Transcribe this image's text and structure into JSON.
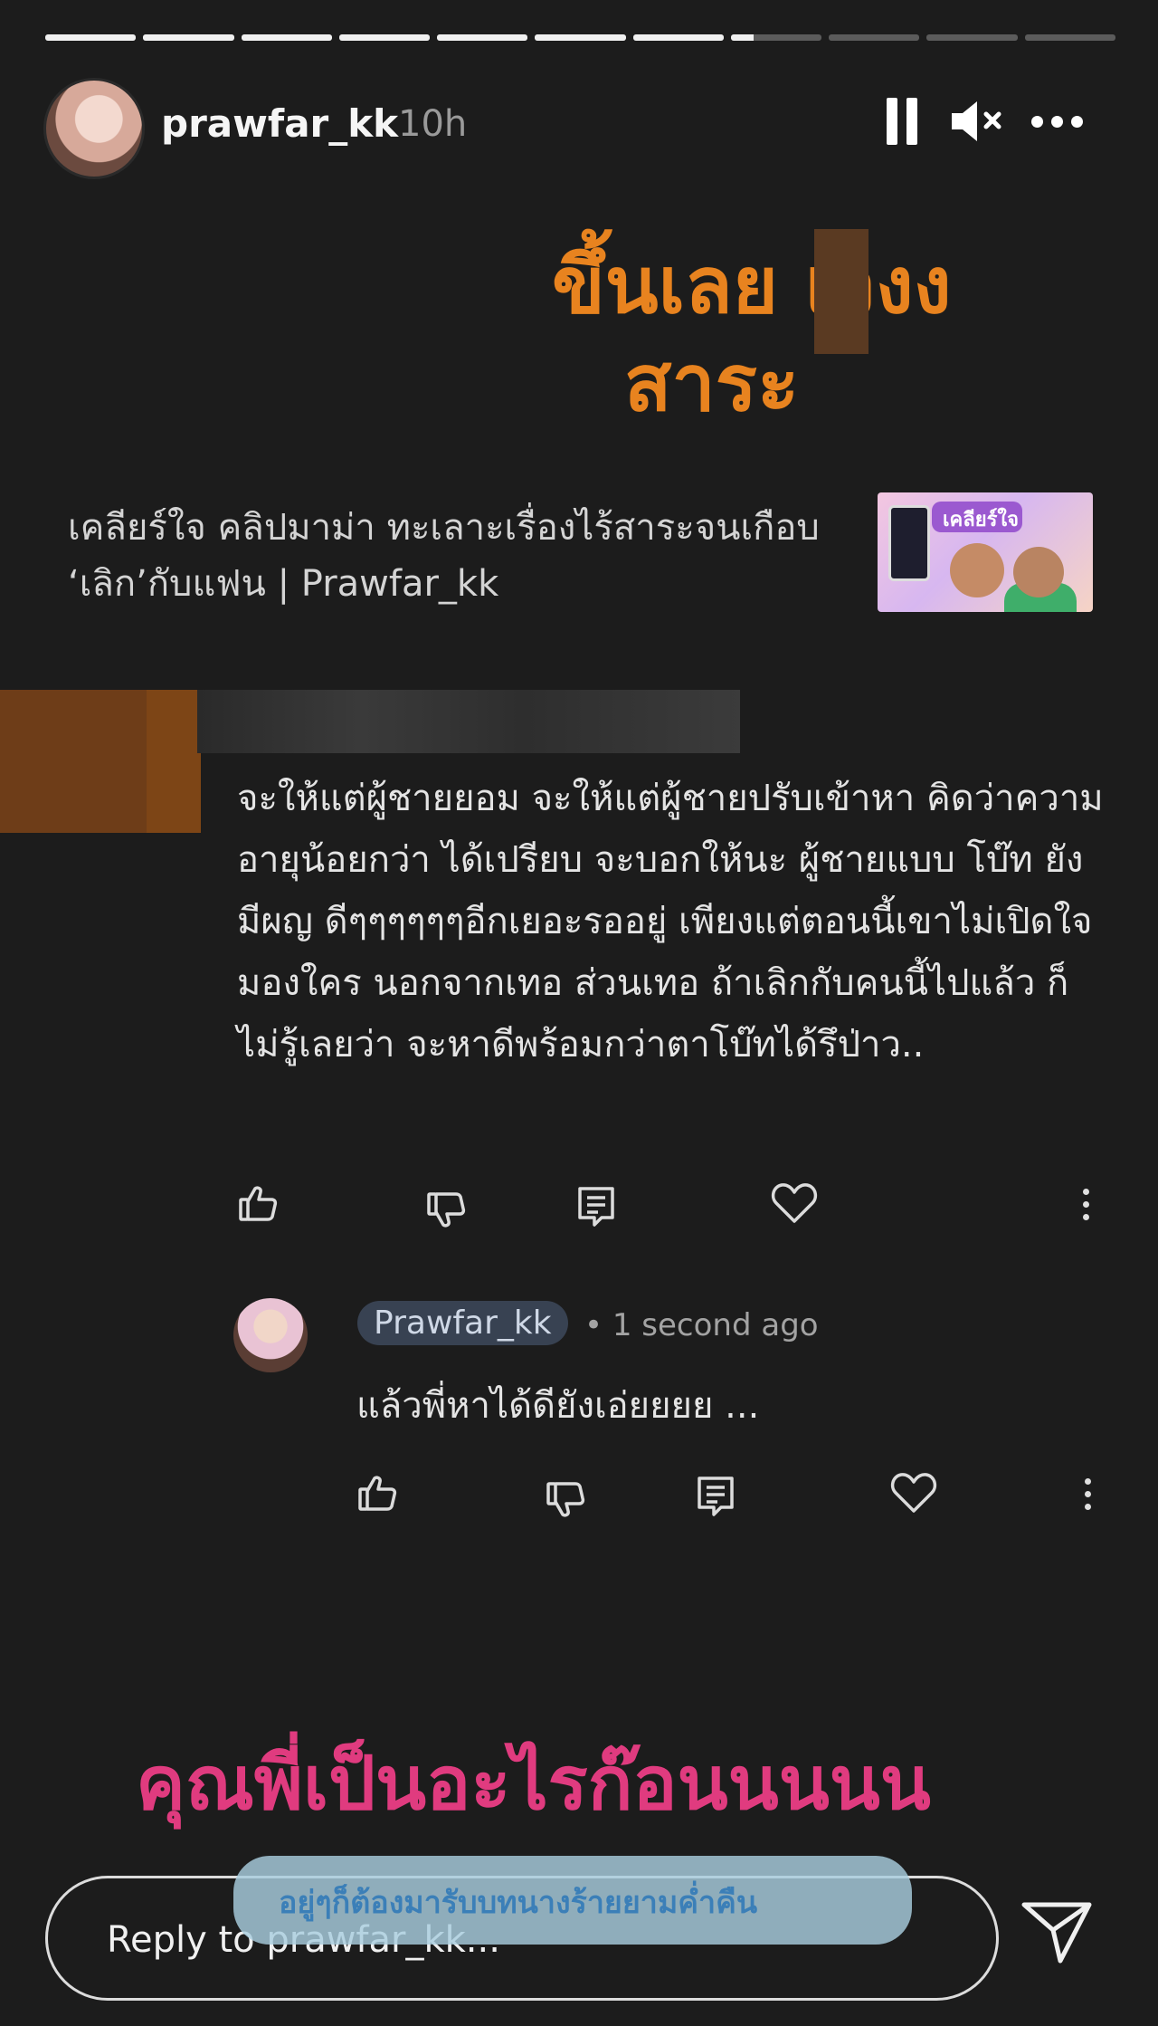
{
  "story": {
    "progress_segments": [
      1,
      1,
      1,
      1,
      1,
      1,
      1,
      0.25,
      0,
      0,
      0
    ],
    "username": "prawfar_kk",
    "time_ago": "10h"
  },
  "headline": {
    "line1": "ขึ้นเลย   เวงง",
    "line2": "สาระ",
    "color": "#e8831f"
  },
  "video": {
    "title": "เคลียร์ใจ คลิปมาม่า ทะเลาะเรื่องไร้สาระจนเกือบ ‘เลิก’กับแฟน | Prawfar_kk",
    "thumbnail_text": "เคลียร์ใจ"
  },
  "comment": {
    "text": "จะให้แต่ผู้ชายยอม จะให้แต่ผู้ชายปรับเข้าหา คิดว่าความอายุน้อยกว่า ได้เปรียบ จะบอกให้นะ ผู้ชายแบบ โบ๊ท ยังมีผญ ดีๆๆๆๆๆๆอีกเยอะรออยู่ เพียงแต่ตอนนี้เขาไม่เปิดใจมองใคร นอกจากเทอ ส่วนเทอ ถ้าเลิกกับคนนี้ไปแล้ว ก็ไม่รู้เลยว่า จะหาดีพร้อมกว่าตาโบ๊ทได้รึป่าว.."
  },
  "reply": {
    "author": "Prawfar_kk",
    "time": "• 1 second ago",
    "text": "แล้วพี่หาได้ดียังเอ่ยยยย ..."
  },
  "caption_pink": {
    "text": "คุณพี่เป็นอะไรก๊อนนนนน",
    "color": "#e03b7f"
  },
  "caption_blue": {
    "text": "อยู่ๆก็ต้องมารับบทนางร้ายยามค่ำคืน"
  },
  "reply_bar": {
    "placeholder": "Reply to prawfar_kk..."
  },
  "icons": [
    "pause-icon",
    "mute-icon",
    "more-icon",
    "like-icon",
    "dislike-icon",
    "reply-icon",
    "heart-icon",
    "kebab-icon",
    "send-icon"
  ]
}
